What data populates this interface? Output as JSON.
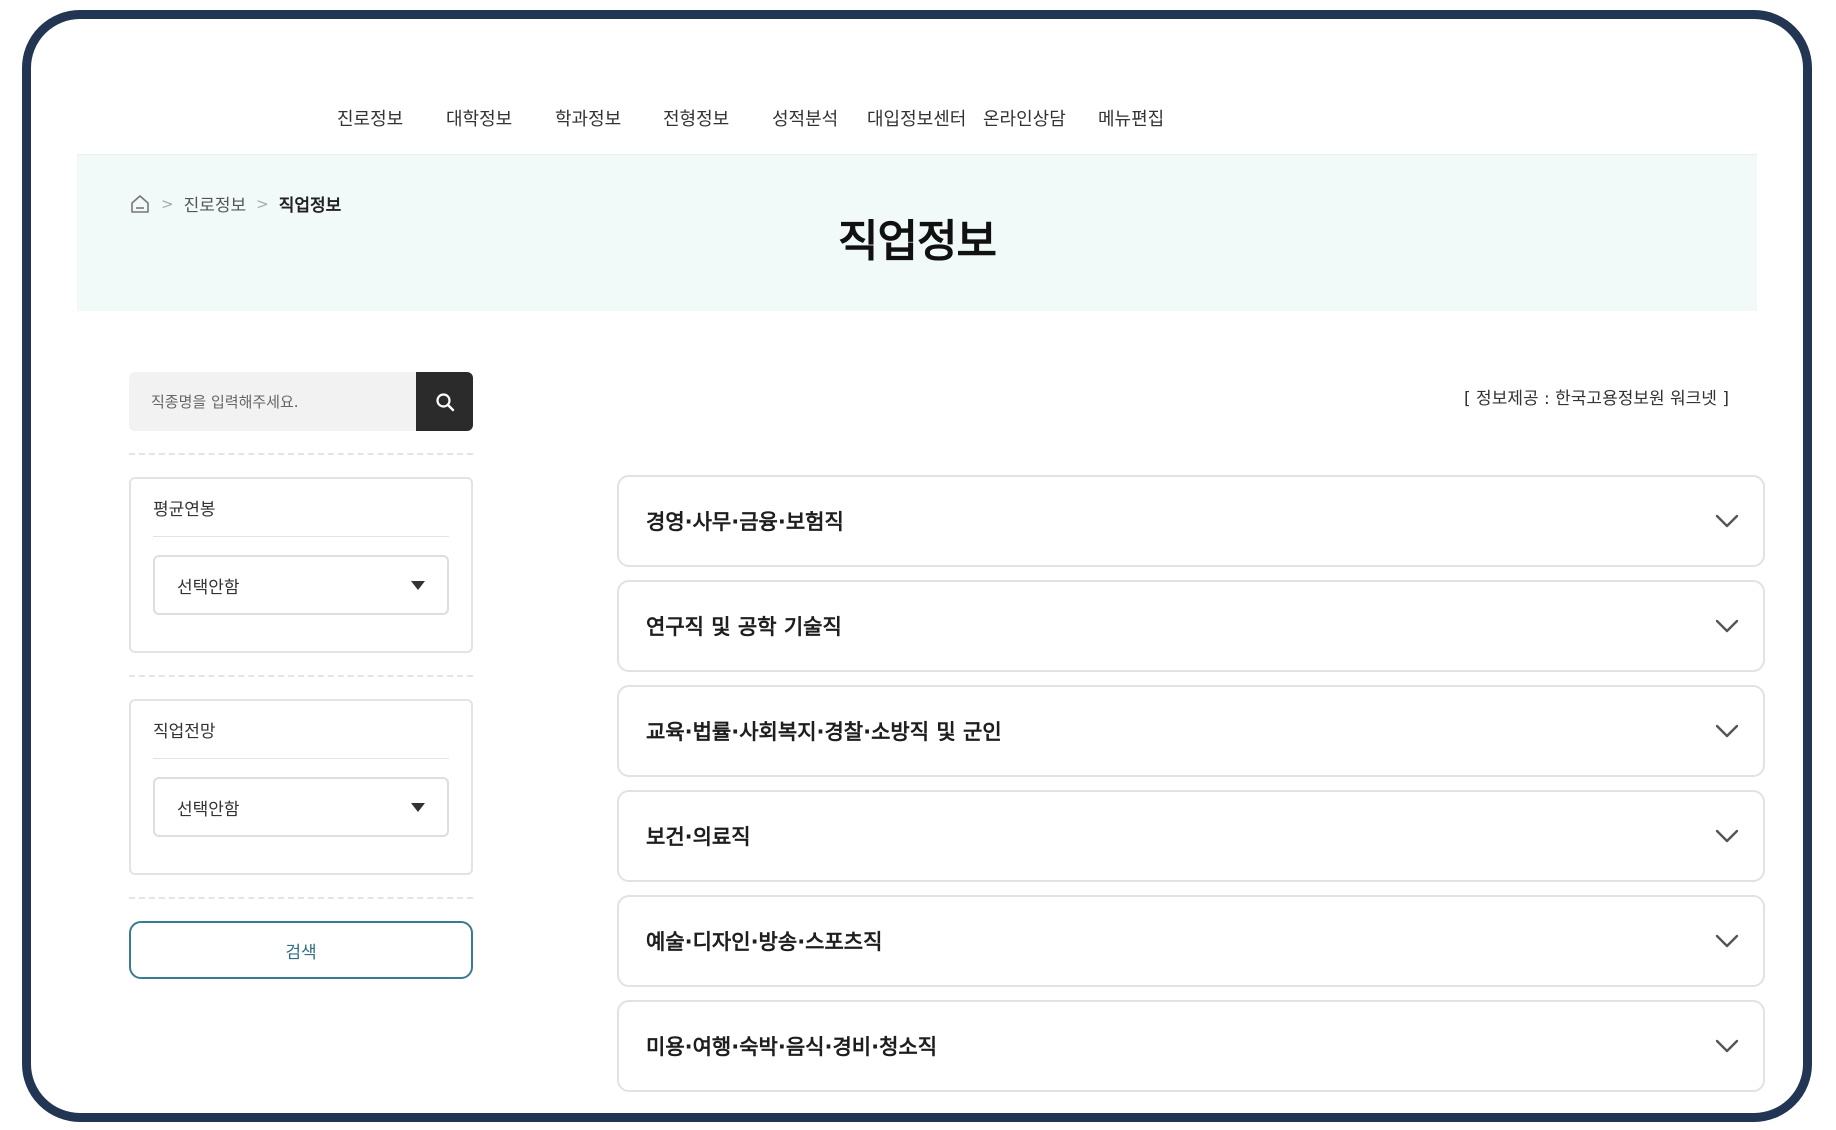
{
  "nav": {
    "items": [
      "진로정보",
      "대학정보",
      "학과정보",
      "전형정보",
      "성적분석",
      "대입정보센터",
      "온라인상담",
      "메뉴편집"
    ]
  },
  "breadcrumb": {
    "home_icon": "home-icon",
    "separator": ">",
    "level1": "진로정보",
    "current": "직업정보"
  },
  "page": {
    "title": "직업정보",
    "source": "[ 정보제공 : 한국고용정보원 워크넷 ]"
  },
  "search": {
    "placeholder": "직종명을 입력해주세요.",
    "icon": "search-icon"
  },
  "filters": [
    {
      "label": "평균연봉",
      "selected": "선택안함"
    },
    {
      "label": "직업전망",
      "selected": "선택안함"
    }
  ],
  "submit_label": "검색",
  "categories": [
    "경영·사무·금융·보험직",
    "연구직 및 공학 기술직",
    "교육·법률·사회복지·경찰·소방직 및 군인",
    "보건·의료직",
    "예술·디자인·방송·스포츠직",
    "미용·여행·숙박·음식·경비·청소직"
  ],
  "colors": {
    "frame": "#223552",
    "hero_bg": "#f1f9f9",
    "search_button": "#2b2b2b",
    "accent": "#2f6e86"
  }
}
